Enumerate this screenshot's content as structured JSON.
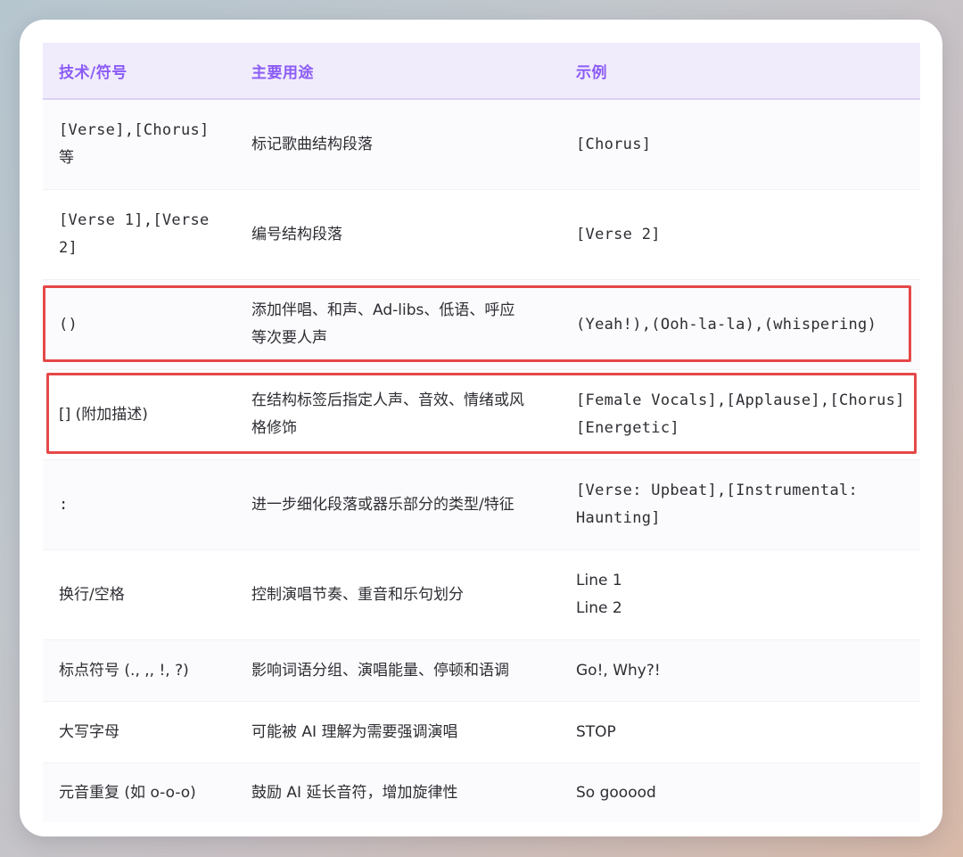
{
  "table": {
    "headers": [
      "技术/符号",
      "主要用途",
      "示例"
    ],
    "rows": [
      {
        "symbol": "[Verse],[Chorus]\n等",
        "usage": "标记歌曲结构段落",
        "example": "[Chorus]"
      },
      {
        "symbol": "[Verse 1],[Verse\n2]",
        "usage": "编号结构段落",
        "example": "[Verse 2]"
      },
      {
        "symbol": "()",
        "usage": "添加伴唱、和声、Ad-libs、低语、呼应\n等次要人声",
        "example": "(Yeah!),(Ooh-la-la),(whispering)"
      },
      {
        "symbol": "[] (附加描述)",
        "usage": "在结构标签后指定人声、音效、情绪或风\n格修饰",
        "example": "[Female Vocals],[Applause],[Chorus]\n[Energetic]"
      },
      {
        "symbol": ":",
        "usage": "进一步细化段落或器乐部分的类型/特征",
        "example": "[Verse: Upbeat],[Instrumental:\nHaunting]"
      },
      {
        "symbol": "换行/空格",
        "usage": "控制演唱节奏、重音和乐句划分",
        "example": "Line 1\nLine 2"
      },
      {
        "symbol": "标点符号 (., ,, !, ?)",
        "usage": "影响词语分组、演唱能量、停顿和语调",
        "example": "Go!, Why?!"
      },
      {
        "symbol": "大写字母",
        "usage": "可能被 AI 理解为需要强调演唱",
        "example": "STOP"
      },
      {
        "symbol": "元音重复 (如 o-o-o)",
        "usage": "鼓励 AI 延长音符，增加旋律性",
        "example": "So gooood"
      }
    ]
  },
  "colors": {
    "header_text": "#8b5cf6",
    "header_bg": "#f1ecfc",
    "highlight_border": "#e54848"
  }
}
